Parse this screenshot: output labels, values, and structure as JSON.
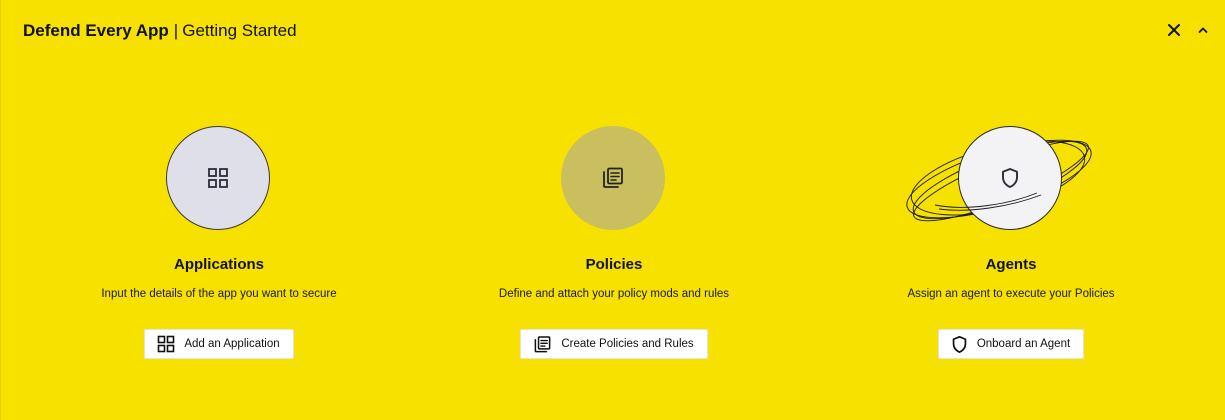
{
  "header": {
    "title": "Defend Every App",
    "separator": "|",
    "subtitle": "Getting Started",
    "close_icon": "close-icon",
    "collapse_icon": "chevron-up-icon"
  },
  "cards": [
    {
      "icon": "grid-icon",
      "title": "Applications",
      "description": "Input the details of the app you want to secure",
      "button_label": "Add an Application"
    },
    {
      "icon": "policy-document-icon",
      "title": "Policies",
      "description": "Define and attach your policy mods and rules",
      "button_label": "Create Policies and Rules"
    },
    {
      "icon": "shield-icon",
      "title": "Agents",
      "description": "Assign an agent to execute your Policies",
      "button_label": "Onboard an Agent"
    }
  ],
  "colors": {
    "background": "#f6e100",
    "applications_circle": "#dedfe9",
    "policies_circle": "#c9bf5e",
    "agents_circle": "#f3f3f5",
    "button_bg": "#ffffff",
    "text": "#111111"
  }
}
